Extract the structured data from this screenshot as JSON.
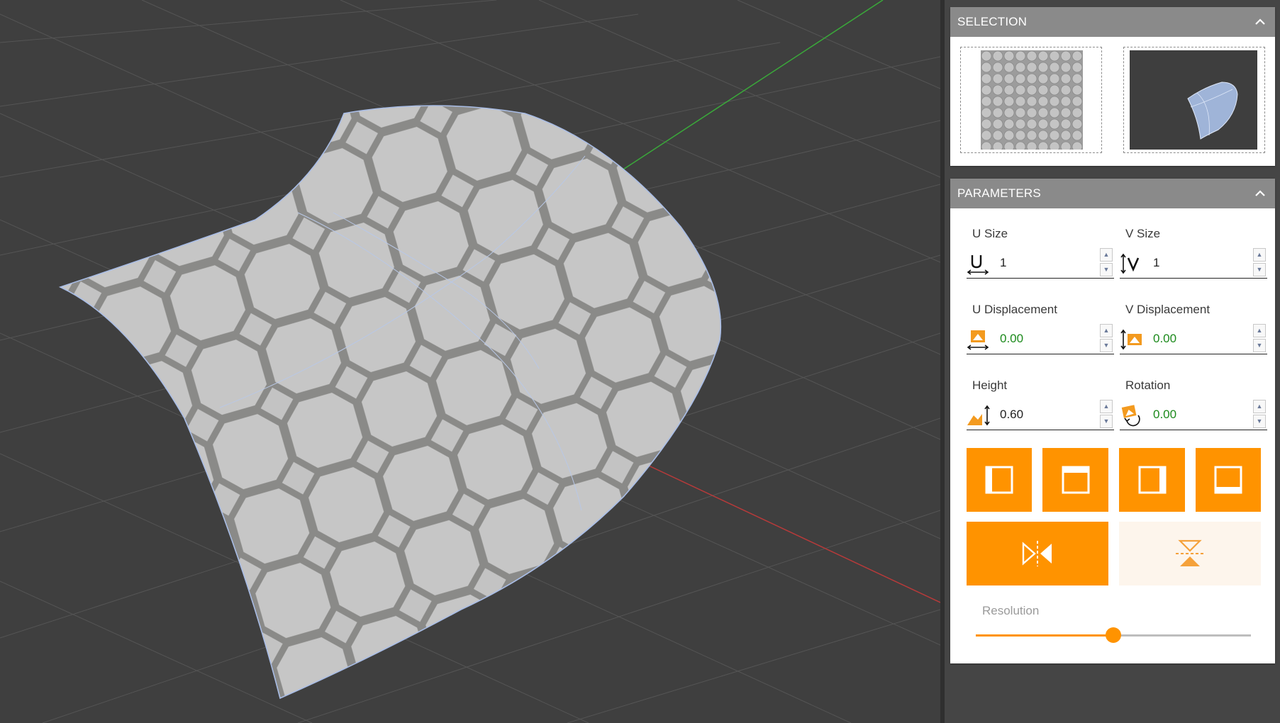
{
  "selection": {
    "title": "SELECTION",
    "thumbnails": [
      "texture-thumbnail",
      "surface-thumbnail"
    ]
  },
  "parameters": {
    "title": "PARAMETERS",
    "u_size": {
      "label": "U Size",
      "value": "1",
      "icon": "u-size-icon"
    },
    "v_size": {
      "label": "V Size",
      "value": "1",
      "icon": "v-size-icon"
    },
    "u_displacement": {
      "label": "U Displacement",
      "value": "0.00",
      "icon": "u-displacement-icon"
    },
    "v_displacement": {
      "label": "V Displacement",
      "value": "0.00",
      "icon": "v-displacement-icon"
    },
    "height": {
      "label": "Height",
      "value": "0.60",
      "icon": "height-icon"
    },
    "rotation": {
      "label": "Rotation",
      "value": "0.00",
      "icon": "rotation-icon"
    },
    "edge_buttons": [
      "align-left-edge-icon",
      "align-top-edge-icon",
      "align-right-edge-icon",
      "align-bottom-edge-icon"
    ],
    "flip_buttons": [
      "flip-horizontal-icon",
      "flip-vertical-icon"
    ],
    "resolution": {
      "label": "Resolution",
      "level": 0.5
    }
  },
  "colors": {
    "accent": "#ff9300",
    "panel_header": "#8a8a8a",
    "viewport": "#3f3f3f",
    "green_value": "#1c8a1c"
  }
}
